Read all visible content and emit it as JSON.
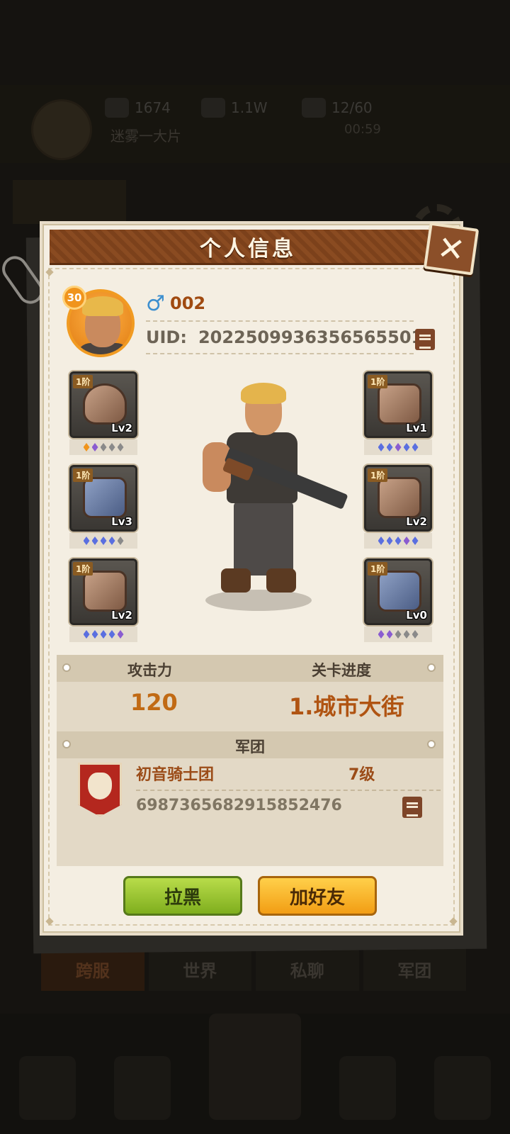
{
  "background": {
    "stats": [
      "1674",
      "1.1W",
      "12/60"
    ],
    "subtitle": "迷雾一大片",
    "subtext": "00:59",
    "tabs": [
      "跨服",
      "世界",
      "私聊",
      "军团"
    ]
  },
  "dialog": {
    "title": "个人信息",
    "close_icon": "close-x-icon",
    "player": {
      "level": "30",
      "gender_symbol": "♂",
      "name": "002",
      "uid_label": "UID:",
      "uid": "2022509936356565501"
    },
    "equipment": {
      "left": [
        {
          "slot": "helmet",
          "tier": "1阶",
          "level": "Lv2",
          "gems": [
            "#f0941c",
            "#8a5cd0",
            "#8a8a8a",
            "#8a8a8a",
            "#8a8a8a"
          ]
        },
        {
          "slot": "armor",
          "tier": "1阶",
          "level": "Lv3",
          "gems": [
            "#5a6fe0",
            "#5a6fe0",
            "#5a6fe0",
            "#5a6fe0",
            "#8a8a8a"
          ]
        },
        {
          "slot": "boots",
          "tier": "1阶",
          "level": "Lv2",
          "gems": [
            "#5a6fe0",
            "#5a6fe0",
            "#5a6fe0",
            "#5a6fe0",
            "#8a5cd0"
          ]
        }
      ],
      "right": [
        {
          "slot": "bracers",
          "tier": "1阶",
          "level": "Lv1",
          "gems": [
            "#5a6fe0",
            "#5a6fe0",
            "#8a5cd0",
            "#5a6fe0",
            "#5a6fe0"
          ]
        },
        {
          "slot": "pants",
          "tier": "1阶",
          "level": "Lv2",
          "gems": [
            "#5a6fe0",
            "#5a6fe0",
            "#5a6fe0",
            "#8a5cd0",
            "#5a6fe0"
          ]
        },
        {
          "slot": "gloves",
          "tier": "1阶",
          "level": "Lv0",
          "gems": [
            "#8a5cd0",
            "#8a5cd0",
            "#8a8a8a",
            "#8a8a8a",
            "#8a8a8a"
          ]
        }
      ]
    },
    "stats": {
      "attack_label": "攻击力",
      "attack_value": "120",
      "progress_label": "关卡进度",
      "progress_value": "1.城市大街"
    },
    "legion": {
      "header": "军团",
      "name": "初音骑士团",
      "level": "7级",
      "id": "6987365682915852476"
    },
    "buttons": {
      "block": "拉黑",
      "add_friend": "加好友"
    }
  }
}
